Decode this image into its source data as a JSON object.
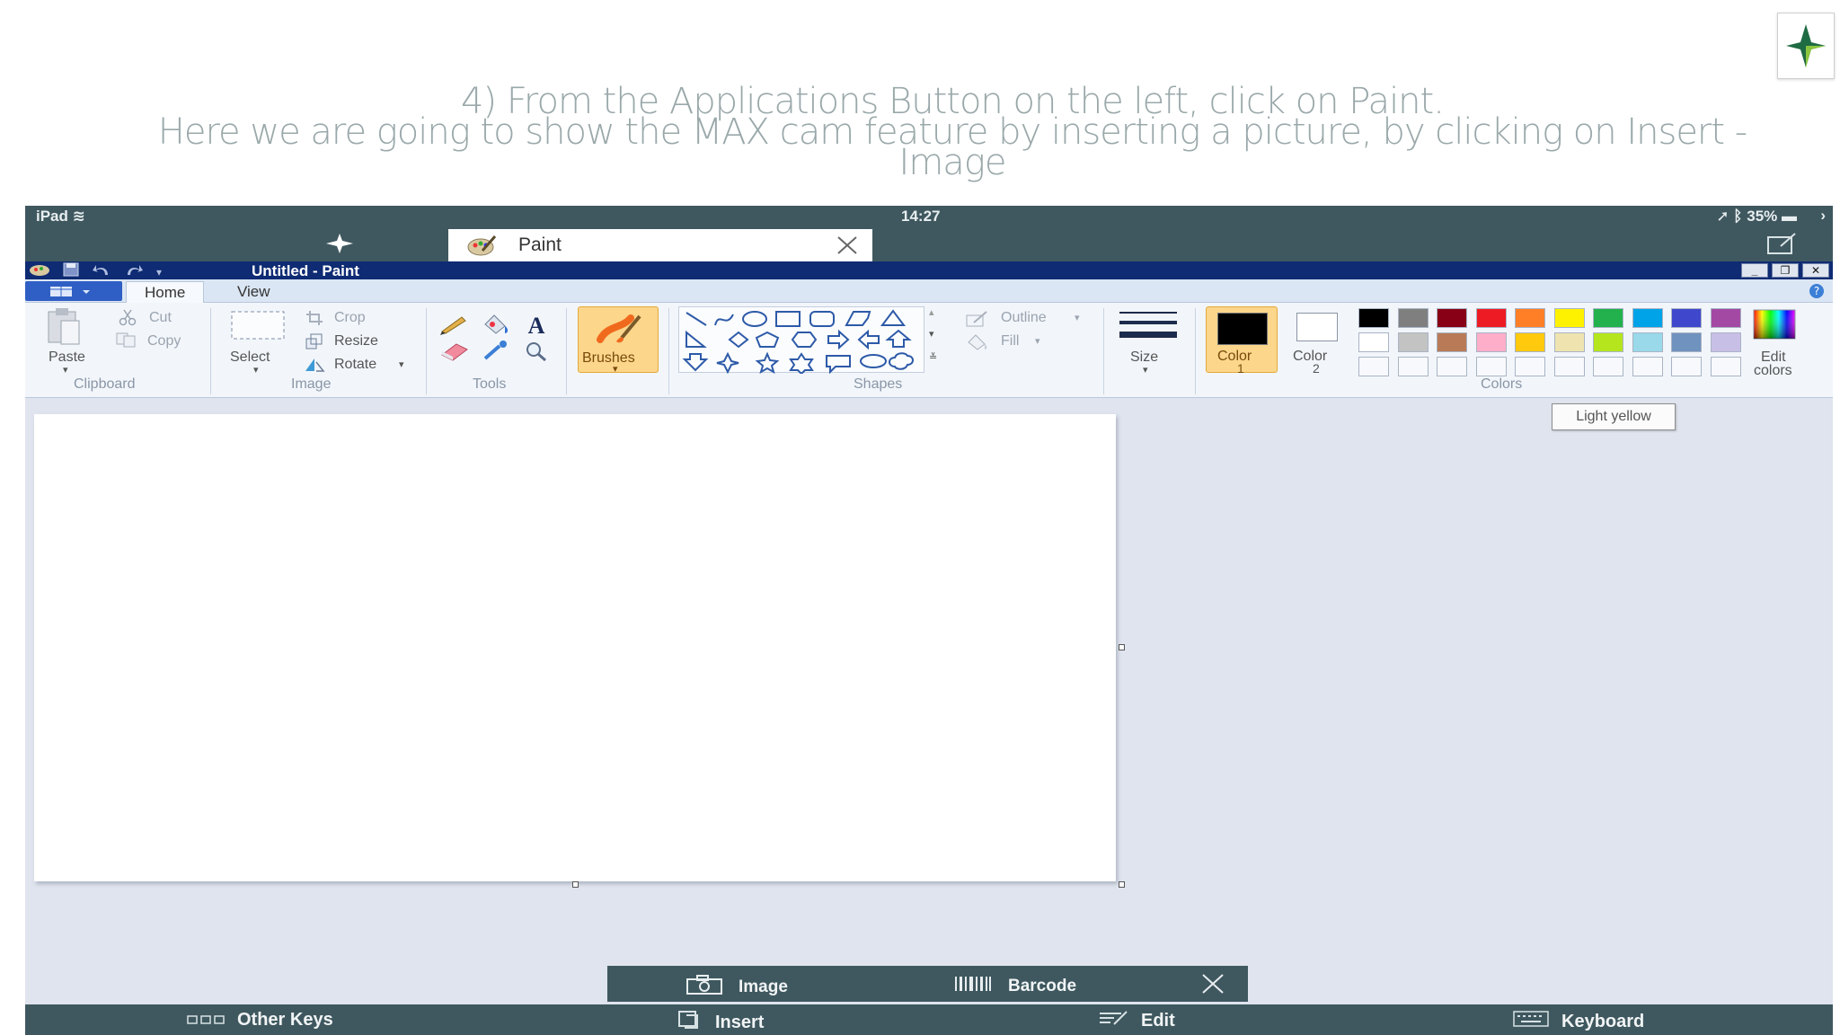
{
  "slide": {
    "heading_line1": "4) From the Applications Button on the left, click on Paint.",
    "heading_line2": "Here we are going to show the MAX cam feature by inserting a picture, by clicking on Insert  -",
    "heading_line3": "Image",
    "logo_icon": "star-logo-icon"
  },
  "status_bar": {
    "device": "iPad",
    "time": "14:27",
    "battery": "35%"
  },
  "browser_tab": {
    "label": "Paint"
  },
  "window": {
    "title": "Untitled - Paint",
    "minimize": "_",
    "restore": "❐",
    "close": "✕"
  },
  "ribbon_tabs": {
    "home": "Home",
    "view": "View"
  },
  "ribbon": {
    "clipboard": {
      "group": "Clipboard",
      "paste": "Paste",
      "cut": "Cut",
      "copy": "Copy"
    },
    "image": {
      "group": "Image",
      "select": "Select",
      "crop": "Crop",
      "resize": "Resize",
      "rotate": "Rotate"
    },
    "tools": {
      "group": "Tools"
    },
    "brushes": {
      "label": "Brushes"
    },
    "shapes": {
      "group": "Shapes",
      "outline": "Outline",
      "fill": "Fill"
    },
    "size": {
      "label": "Size"
    },
    "colors": {
      "group": "Colors",
      "color1": "Color",
      "color1_num": "1",
      "color2": "Color",
      "color2_num": "2",
      "edit": "Edit",
      "edit2": "colors",
      "palette_row1": [
        "#000000",
        "#7f7f7f",
        "#880015",
        "#ed1c24",
        "#ff7f27",
        "#fff200",
        "#22b14c",
        "#00a2e8",
        "#3f48cc",
        "#a349a4"
      ],
      "palette_row2": [
        "#ffffff",
        "#c3c3c3",
        "#b97a57",
        "#ffaec9",
        "#ffc90e",
        "#efe4b0",
        "#b5e61d",
        "#99d9ea",
        "#7092be",
        "#c8bfe7"
      ]
    }
  },
  "tooltip": "Light yellow",
  "maxcam_bar": {
    "image": "Image",
    "barcode": "Barcode"
  },
  "bottom_bar": {
    "other_keys": "Other Keys",
    "insert": "Insert",
    "edit": "Edit",
    "keyboard": "Keyboard"
  }
}
